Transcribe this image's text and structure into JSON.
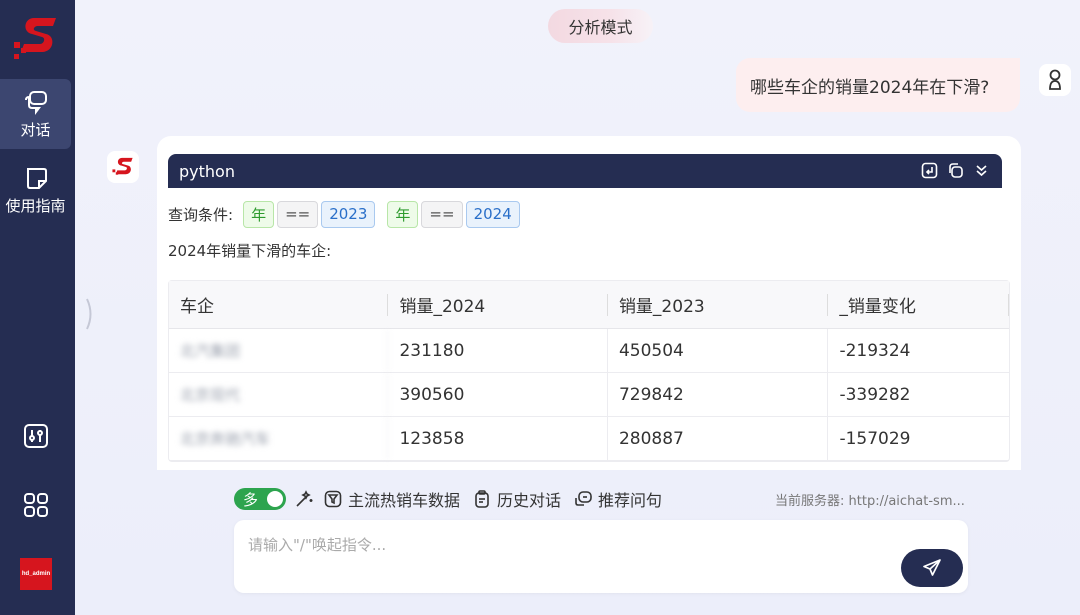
{
  "sidebar": {
    "nav": [
      {
        "label": "对话",
        "icon": "chat-icon"
      },
      {
        "label": "使用指南",
        "icon": "guide-icon"
      }
    ],
    "tools": [
      {
        "icon": "settings-sliders-icon"
      },
      {
        "icon": "apps-grid-icon"
      }
    ],
    "avatar_text": "hd_admin"
  },
  "header": {
    "mode_label": "分析模式"
  },
  "conversation": {
    "user_message": "哪些车企的销量2024年在下滑?",
    "code_block": {
      "language": "python"
    },
    "condition_label": "查询条件:",
    "conditions": [
      {
        "field": "年",
        "op": "==",
        "value": "2023"
      },
      {
        "field": "年",
        "op": "==",
        "value": "2024"
      }
    ],
    "result_title": "2024年销量下滑的车企:",
    "table": {
      "columns": [
        "车企",
        "销量_2024",
        "销量_2023",
        "_销量变化"
      ],
      "rows": [
        [
          "北汽集团",
          "231180",
          "450504",
          "-219324"
        ],
        [
          "北京现代",
          "390560",
          "729842",
          "-339282"
        ],
        [
          "北京奔驰汽车",
          "123858",
          "280887",
          "-157029"
        ]
      ]
    }
  },
  "toolbar": {
    "toggle_label": "多",
    "items": [
      {
        "label": "主流热销车数据",
        "icon": "filter-icon"
      },
      {
        "label": "历史对话",
        "icon": "clipboard-icon"
      },
      {
        "label": "推荐问句",
        "icon": "question-chat-icon"
      }
    ],
    "server_text": "当前服务器: http://aichat-sm..."
  },
  "input": {
    "placeholder": "请输入\"/\"唤起指令..."
  },
  "colors": {
    "sidebar": "#252d52",
    "accent_green": "#2da44e",
    "brand_red": "#d6151e"
  }
}
